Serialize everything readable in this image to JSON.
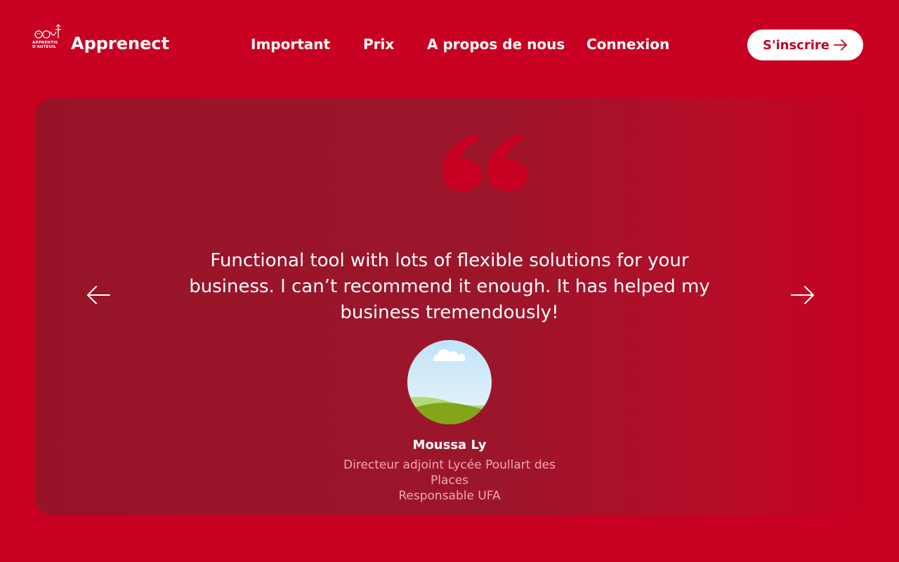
{
  "header": {
    "logo_text": "APPRENTIS D'AUTEUIL",
    "brand": "Apprenect",
    "nav": [
      {
        "label": "Important"
      },
      {
        "label": "Prix"
      },
      {
        "label": "A propos de nous"
      },
      {
        "label": "Connexion"
      }
    ],
    "signup_label": "S'inscrire",
    "signup_icon": "arrow-right-icon"
  },
  "testimonial": {
    "quote_icon": "quote-icon",
    "quote": "Functional tool with lots of flexible solutions for your business. I can’t recommend it enough. It has helped my business tremendously!",
    "prev_icon": "arrow-left-icon",
    "next_icon": "arrow-right-icon",
    "name": "Moussa Ly",
    "role_line1": "Directeur adjoint Lycée Poullart des Places",
    "role_line2": "Responsable UFA"
  },
  "colors": {
    "background": "#C80022",
    "card": "#9C162B",
    "accent": "#C80022",
    "role_text": "#F2A6B8"
  }
}
